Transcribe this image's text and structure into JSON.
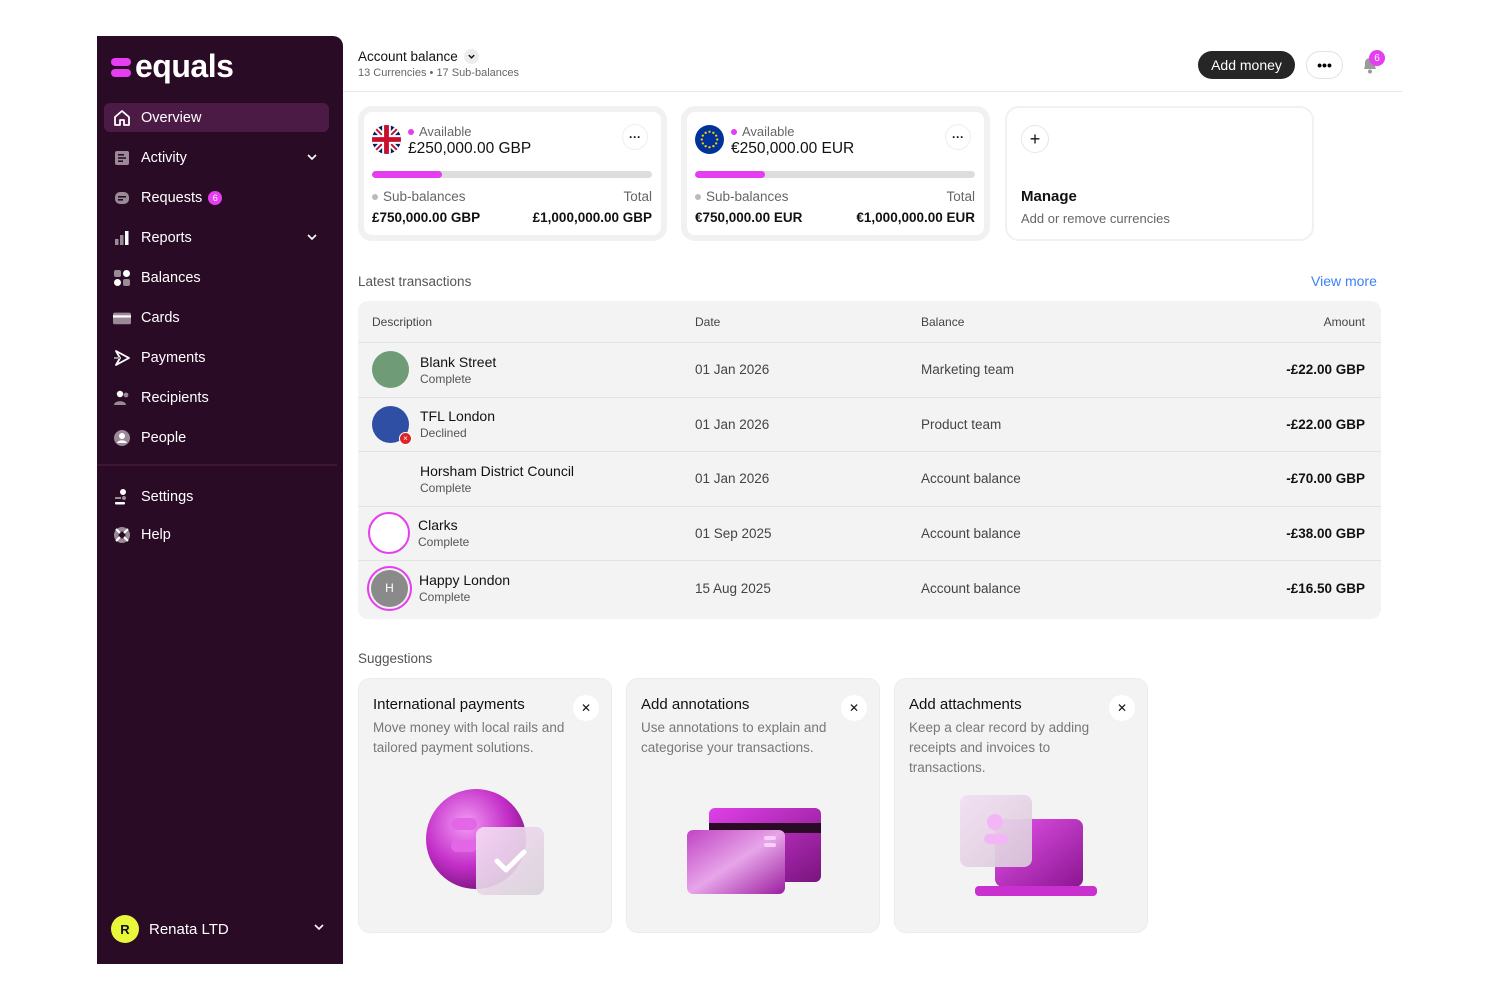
{
  "brand": {
    "name": "equals",
    "accent": "#e53df0",
    "sidebar_bg": "#2a0b26"
  },
  "sidebar": {
    "items": [
      {
        "label": "Overview",
        "icon": "home-icon",
        "active": true
      },
      {
        "label": "Activity",
        "icon": "activity-icon",
        "expandable": true
      },
      {
        "label": "Requests",
        "icon": "requests-icon",
        "badge": "6"
      },
      {
        "label": "Reports",
        "icon": "reports-icon",
        "expandable": true
      },
      {
        "label": "Balances",
        "icon": "balances-icon"
      },
      {
        "label": "Cards",
        "icon": "card-icon"
      },
      {
        "label": "Payments",
        "icon": "payments-icon"
      },
      {
        "label": "Recipients",
        "icon": "recipients-icon"
      },
      {
        "label": "People",
        "icon": "people-icon"
      }
    ],
    "secondary": [
      {
        "label": "Settings",
        "icon": "settings-icon"
      },
      {
        "label": "Help",
        "icon": "help-icon"
      }
    ],
    "org": {
      "initial": "R",
      "name": "Renata LTD"
    }
  },
  "header": {
    "title": "Account balance",
    "subtitle": "13 Currencies • 17 Sub-balances",
    "add_money": "Add money",
    "more": "•••",
    "notifications": "6"
  },
  "balances": [
    {
      "currency": "GBP",
      "flag": "uk-flag-icon",
      "available_label": "Available",
      "available": "£250,000.00 GBP",
      "progress": 0.25,
      "sub_label": "Sub-balances",
      "sub_value": "£750,000.00 GBP",
      "total_label": "Total",
      "total_value": "£1,000,000.00 GBP"
    },
    {
      "currency": "EUR",
      "flag": "eu-flag-icon",
      "available_label": "Available",
      "available": "€250,000.00 EUR",
      "progress": 0.25,
      "sub_label": "Sub-balances",
      "sub_value": "€750,000.00 EUR",
      "total_label": "Total",
      "total_value": "€1,000,000.00 EUR"
    }
  ],
  "manage": {
    "title": "Manage",
    "subtitle": "Add or remove currencies"
  },
  "transactions": {
    "title": "Latest transactions",
    "view_more": "View more",
    "columns": [
      "Description",
      "Date",
      "Balance",
      "Amount"
    ],
    "rows": [
      {
        "merchant": "Blank Street",
        "status": "Complete",
        "date": "01 Jan 2026",
        "balance": "Marketing team",
        "amount": "-£22.00 GBP",
        "avatar_color": "#6f9b76"
      },
      {
        "merchant": "TFL London",
        "status": "Declined",
        "date": "01 Jan 2026",
        "balance": "Product team",
        "amount": "-£22.00 GBP",
        "avatar_color": "#2e4fa3"
      },
      {
        "merchant": "Horsham District Council",
        "status": "Complete",
        "date": "01 Jan 2026",
        "balance": "Account balance",
        "amount": "-£70.00 GBP",
        "avatar_color": ""
      },
      {
        "merchant": "Clarks",
        "status": "Complete",
        "date": "01 Sep 2025",
        "balance": "Account balance",
        "amount": "-£38.00 GBP",
        "avatar_color": "#ffffff"
      },
      {
        "merchant": "Happy London",
        "status": "Complete",
        "date": "15 Aug 2025",
        "balance": "Account balance",
        "amount": "-£16.50 GBP",
        "avatar_color": "#8a8a8a",
        "initial": "H"
      }
    ]
  },
  "suggestions": {
    "title": "Suggestions",
    "cards": [
      {
        "title": "International payments",
        "desc": "Move money with local rails and tailored payment solutions."
      },
      {
        "title": "Add annotations",
        "desc": "Use annotations to explain and categorise your transactions."
      },
      {
        "title": "Add attachments",
        "desc": "Keep a clear record by adding receipts and invoices to transactions."
      }
    ]
  }
}
